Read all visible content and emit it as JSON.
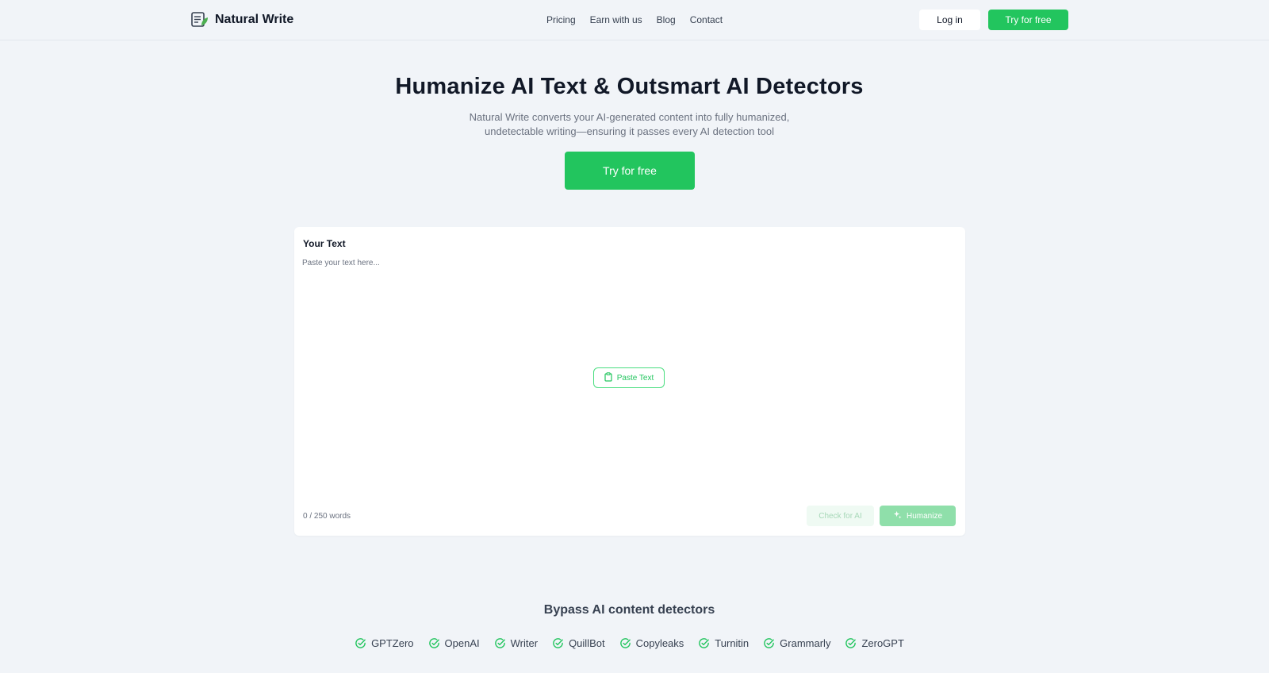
{
  "header": {
    "logo_text": "Natural Write",
    "nav": [
      "Pricing",
      "Earn with us",
      "Blog",
      "Contact"
    ],
    "login_label": "Log in",
    "try_label": "Try for free"
  },
  "hero": {
    "title": "Humanize AI Text & Outsmart AI Detectors",
    "subtitle_line1": "Natural Write converts your AI-generated content into fully humanized,",
    "subtitle_line2": "undetectable writing—ensuring it passes every AI detection tool",
    "cta_label": "Try for free"
  },
  "editor": {
    "title": "Your Text",
    "placeholder": "Paste your text here...",
    "paste_label": "Paste Text",
    "word_count": "0 / 250 words",
    "check_label": "Check for AI",
    "humanize_label": "Humanize"
  },
  "bypass": {
    "title": "Bypass AI content detectors",
    "detectors": [
      "GPTZero",
      "OpenAI",
      "Writer",
      "QuillBot",
      "Copyleaks",
      "Turnitin",
      "Grammarly",
      "ZeroGPT"
    ]
  },
  "colors": {
    "accent": "#22c55e",
    "background": "#f1f4f8"
  }
}
